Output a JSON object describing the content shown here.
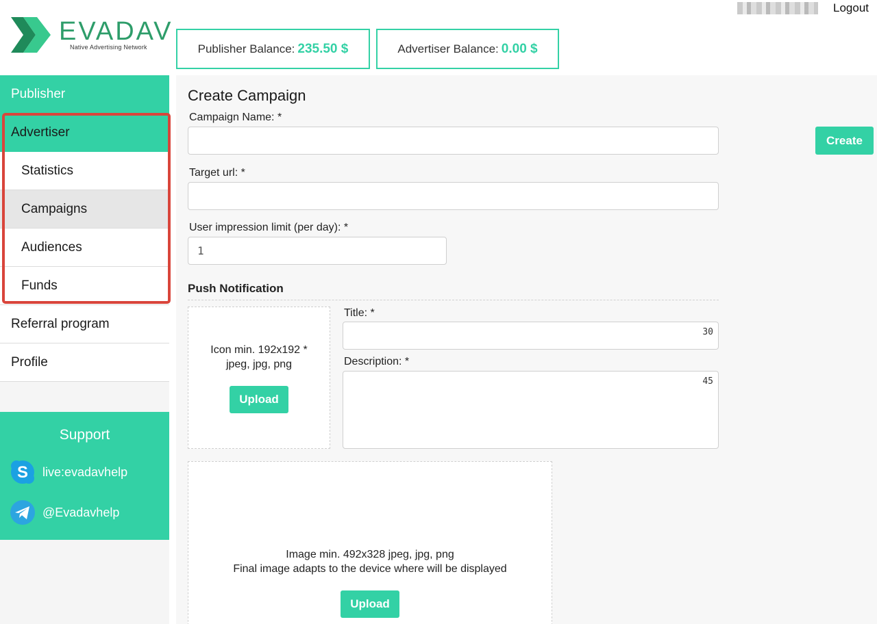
{
  "header": {
    "logo_text": "EVADAV",
    "logo_subtitle": "Native Advertising Network",
    "publisher_balance_label": "Publisher Balance:",
    "publisher_balance_value": "235.50 $",
    "advertiser_balance_label": "Advertiser Balance:",
    "advertiser_balance_value": "0.00 $",
    "logout_label": "Logout"
  },
  "sidebar": {
    "items": [
      {
        "label": "Publisher"
      },
      {
        "label": "Advertiser"
      },
      {
        "label": "Statistics"
      },
      {
        "label": "Campaigns"
      },
      {
        "label": "Audiences"
      },
      {
        "label": "Funds"
      },
      {
        "label": "Referral program"
      },
      {
        "label": "Profile"
      }
    ],
    "support": {
      "title": "Support",
      "skype": "live:evadavhelp",
      "telegram": "@Evadavhelp"
    }
  },
  "form": {
    "title": "Create Campaign",
    "campaign_name_label": "Campaign Name: *",
    "campaign_name_value": "",
    "create_button": "Create",
    "target_url_label": "Target url: *",
    "target_url_value": "",
    "impression_limit_label": "User impression limit (per day): *",
    "impression_limit_value": "1",
    "push_section_title": "Push Notification",
    "icon_hint_line1": "Icon min. 192x192 *",
    "icon_hint_line2": "jpeg, jpg, png",
    "icon_upload_button": "Upload",
    "title_label": "Title: *",
    "title_counter": "30",
    "description_label": "Description: *",
    "description_counter": "45",
    "image_hint_line1": "Image min. 492x328 jpeg, jpg, png",
    "image_hint_line2": "Final image adapts to the device where will be displayed",
    "image_upload_button": "Upload"
  },
  "colors": {
    "accent": "#33d1a5",
    "logo_green": "#2e9d6a",
    "highlight_red": "#d9453b"
  }
}
